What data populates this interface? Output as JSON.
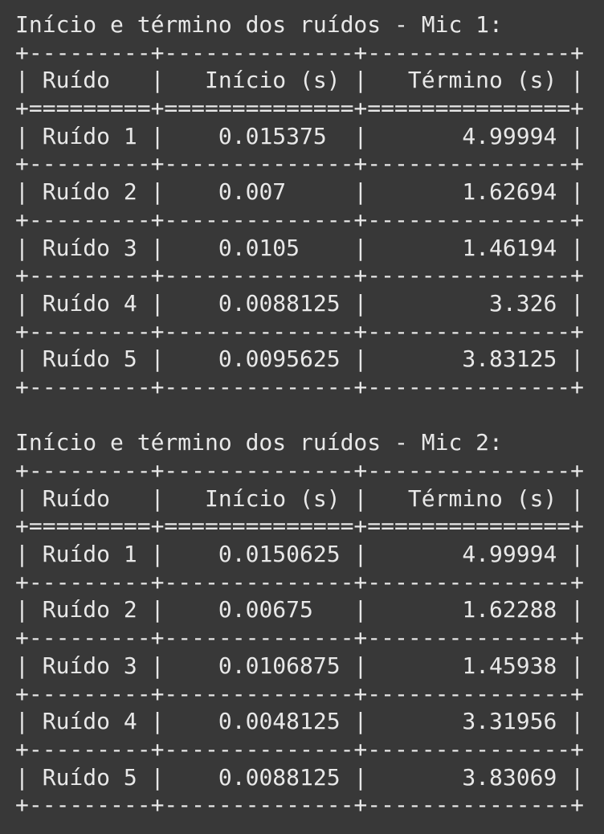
{
  "tables": [
    {
      "title": "Início e término dos ruídos - Mic 1:",
      "headers": [
        "Ruído",
        "Início (s)",
        "Término (s)"
      ],
      "rows": [
        [
          "Ruído 1",
          "0.015375",
          "4.99994"
        ],
        [
          "Ruído 2",
          "0.007",
          "1.62694"
        ],
        [
          "Ruído 3",
          "0.0105",
          "1.46194"
        ],
        [
          "Ruído 4",
          "0.0088125",
          "3.326"
        ],
        [
          "Ruído 5",
          "0.0095625",
          "3.83125"
        ]
      ]
    },
    {
      "title": "Início e término dos ruídos - Mic 2:",
      "headers": [
        "Ruído",
        "Início (s)",
        "Término (s)"
      ],
      "rows": [
        [
          "Ruído 1",
          "0.0150625",
          "4.99994"
        ],
        [
          "Ruído 2",
          "0.00675",
          "1.62288"
        ],
        [
          "Ruído 3",
          "0.0106875",
          "1.45938"
        ],
        [
          "Ruído 4",
          "0.0048125",
          "3.31956"
        ],
        [
          "Ruído 5",
          "0.0088125",
          "3.83069"
        ]
      ]
    }
  ]
}
